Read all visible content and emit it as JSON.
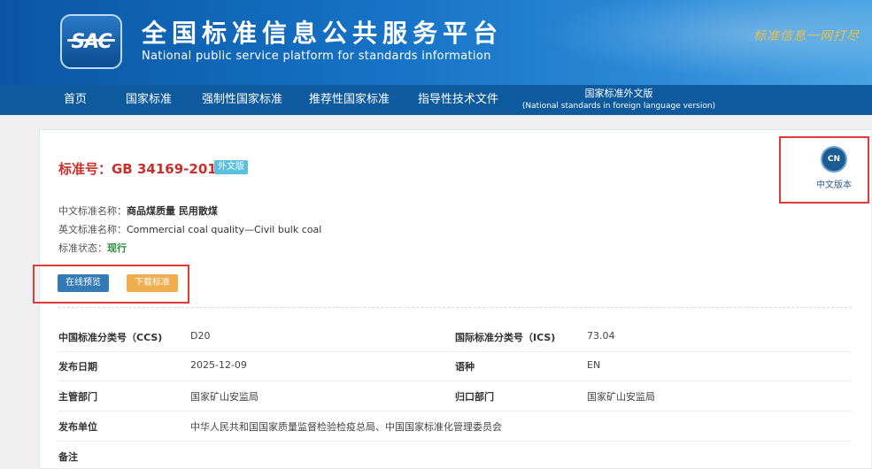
{
  "header": {
    "logo_text": "SAC",
    "title": "全国标准信息公共服务平台",
    "subtitle": "National public service platform  for standards information",
    "slogan": "标准信息一网打尽"
  },
  "nav": {
    "home": "首页",
    "national": "国家标准",
    "mandatory": "强制性国家标准",
    "recommended": "推荐性国家标准",
    "guidance": "指导性技术文件",
    "foreign": "国家标准外文版",
    "foreign_en": "(National standards in foreign language version)"
  },
  "standard": {
    "number": "标准号：GB 34169-2017",
    "badge": "外文版",
    "cn_name_label": "中文标准名称：",
    "cn_name": "商品煤质量 民用散煤",
    "en_name_label": "英文标准名称：",
    "en_name": "Commercial coal quality—Civil bulk coal",
    "status_label": "标准状态：",
    "status": "现行"
  },
  "actions": {
    "preview": "在线预览",
    "download": "下载标准"
  },
  "cn_version": {
    "icon_text": "CN",
    "label": "中文版本"
  },
  "details": {
    "ccs_label": "中国标准分类号（CCS)",
    "ccs": "D20",
    "ics_label": "国际标准分类号（ICS)",
    "ics": "73.04",
    "pub_date_label": "发布日期",
    "pub_date": "2025-12-09",
    "lang_label": "语种",
    "lang": "EN",
    "dept_label": "主管部门",
    "dept": "国家矿山安监局",
    "owner_label": "归口部门",
    "owner": "国家矿山安监局",
    "issuer_label": "发布单位",
    "issuer": "中华人民共和国国家质量监督检验检疫总局、中国国家标准化管理委员会",
    "remark_label": "备注"
  }
}
